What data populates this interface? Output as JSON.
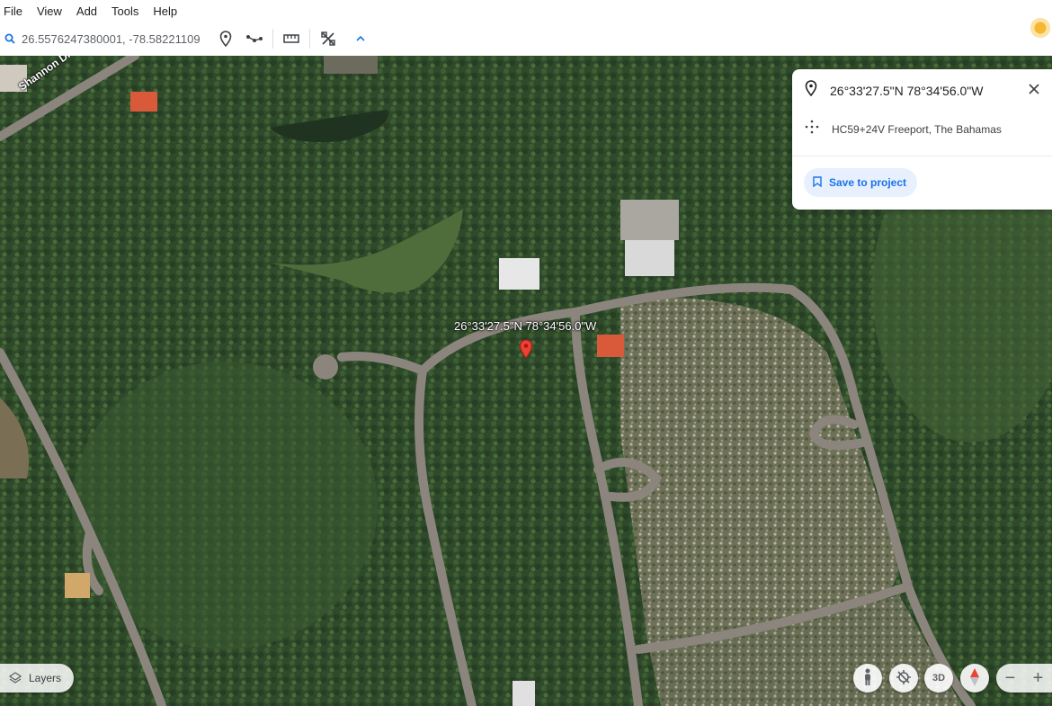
{
  "menu": [
    "File",
    "View",
    "Add",
    "Tools",
    "Help"
  ],
  "search": {
    "value": "26.5576247380001, -78.58221109"
  },
  "toolbar": {
    "icons": [
      "search-icon",
      "placemark-icon",
      "path-icon",
      "ruler-icon",
      "satellite-tools-icon",
      "chevron-up-icon"
    ]
  },
  "map": {
    "street_label": "Shannon Dr",
    "coord_label": "26°33'27.5\"N 78°34'56.0\"W"
  },
  "card": {
    "title": "26°33'27.5\"N 78°34'56.0\"W",
    "plus_code": "HC59+24V Freeport, The Bahamas",
    "save_label": "Save to project"
  },
  "controls": {
    "layers_label": "Layers",
    "three_d_label": "3D",
    "zoom_out": "−",
    "zoom_in": "+"
  },
  "colors": {
    "accent": "#1a73e8",
    "pin": "#ea4335"
  }
}
